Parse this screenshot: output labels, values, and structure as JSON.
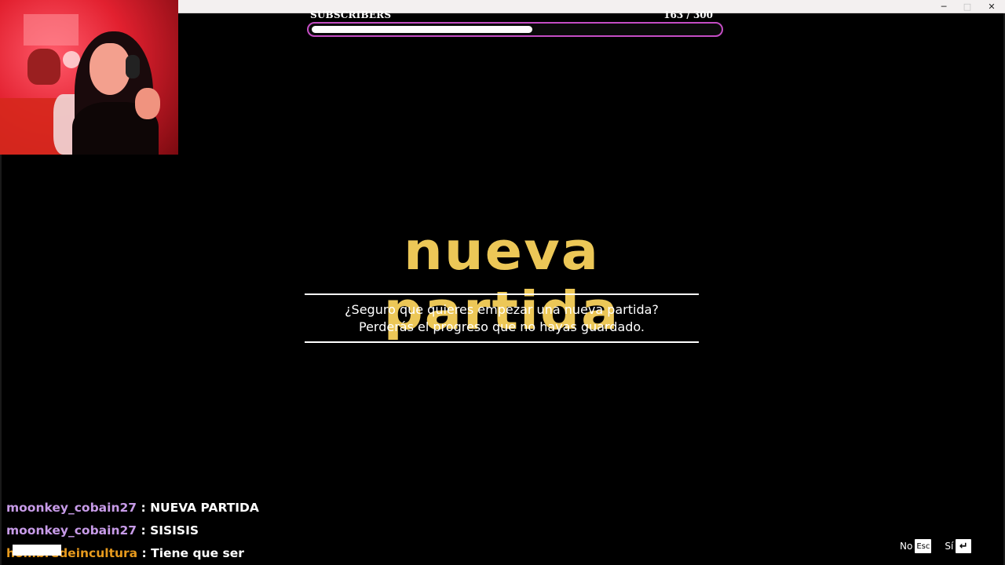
{
  "window": {
    "minimize_icon": "─",
    "maximize_icon": "□",
    "close_icon": "✕"
  },
  "overlay": {
    "goal_label": "SUBSCRIBERS",
    "goal_count": "163 / 300",
    "goal_current": 163,
    "goal_target": 300
  },
  "dialog": {
    "title": "nueva partida",
    "line1": "¿Seguro que quieres empezar una nueva partida?",
    "line2": "Perderás el progreso que no hayas guardado."
  },
  "chat": [
    {
      "user": "moonkey_cobain27",
      "sep": " : ",
      "text": "NUEVA PARTIDA",
      "color": "#c79be8"
    },
    {
      "user": "moonkey_cobain27",
      "sep": " : ",
      "text": "SISISIS",
      "color": "#c79be8"
    },
    {
      "user": "hombredeincultura",
      "sep": " : ",
      "text": "Tiene que ser",
      "color": "#e79a1d"
    }
  ],
  "prompts": {
    "no_label": "No",
    "no_key": "Esc",
    "yes_label": "Sí",
    "yes_key": "↵"
  },
  "colors": {
    "title_yellow": "#ecc757",
    "goal_border": "#c44dc4"
  }
}
